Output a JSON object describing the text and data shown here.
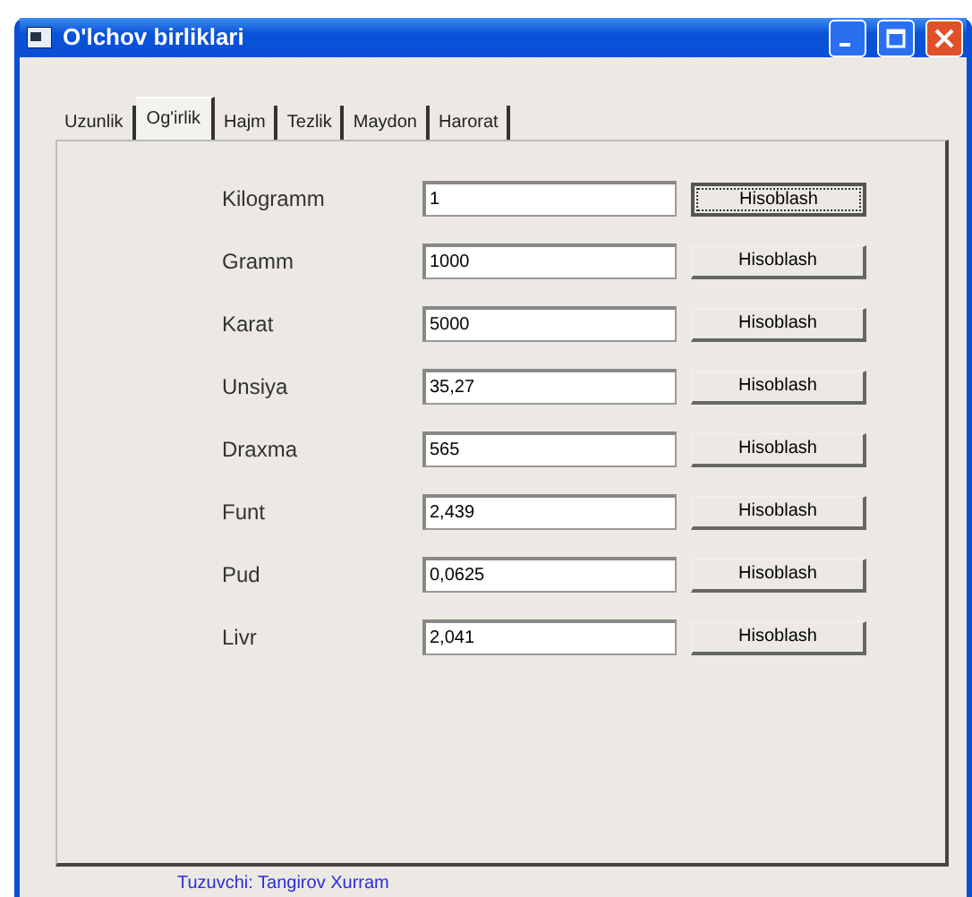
{
  "window": {
    "title": "O'lchov birliklari"
  },
  "tabs": [
    {
      "label": "Uzunlik",
      "selected": false
    },
    {
      "label": "Og'irlik",
      "selected": true
    },
    {
      "label": "Hajm",
      "selected": false
    },
    {
      "label": "Tezlik",
      "selected": false
    },
    {
      "label": "Maydon",
      "selected": false
    },
    {
      "label": "Harorat",
      "selected": false
    }
  ],
  "rows": [
    {
      "label": "Kilogramm",
      "value": "1",
      "button": "Hisoblash",
      "focused": true
    },
    {
      "label": "Gramm",
      "value": "1000",
      "button": "Hisoblash",
      "focused": false
    },
    {
      "label": "Karat",
      "value": "5000",
      "button": "Hisoblash",
      "focused": false
    },
    {
      "label": "Unsiya",
      "value": "35,27",
      "button": "Hisoblash",
      "focused": false
    },
    {
      "label": "Draxma",
      "value": "565",
      "button": "Hisoblash",
      "focused": false
    },
    {
      "label": "Funt",
      "value": "2,439",
      "button": "Hisoblash",
      "focused": false
    },
    {
      "label": "Pud",
      "value": "0,0625",
      "button": "Hisoblash",
      "focused": false
    },
    {
      "label": "Livr",
      "value": "2,041",
      "button": "Hisoblash",
      "focused": false
    }
  ],
  "footer": "Tuzuvchi: Tangirov Xurram"
}
